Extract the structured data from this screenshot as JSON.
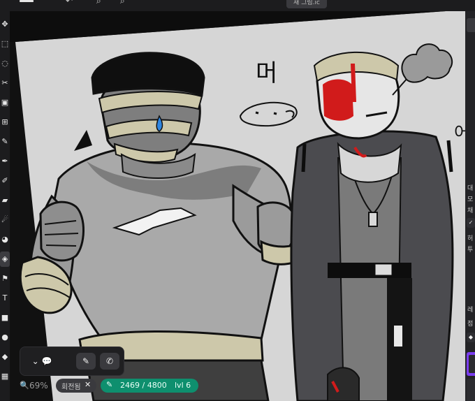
{
  "app": {
    "doc_title": "새 그림.ic",
    "accent": "#0e8f6e",
    "layer_accent": "#7a3cf0"
  },
  "left_toolbar": {
    "tools": [
      {
        "name": "move-tool-icon",
        "glyph": "✥"
      },
      {
        "name": "rect-select-icon",
        "glyph": "⬚"
      },
      {
        "name": "lasso-select-icon",
        "glyph": "◌"
      },
      {
        "name": "magic-wand-icon",
        "glyph": "✂"
      },
      {
        "name": "transform-icon",
        "glyph": "▣"
      },
      {
        "name": "crop-icon",
        "glyph": "⊞"
      },
      {
        "name": "eyedropper-icon",
        "glyph": "✎"
      },
      {
        "name": "pen-icon",
        "glyph": "✒"
      },
      {
        "name": "brush-icon",
        "glyph": "✐"
      },
      {
        "name": "eraser-icon",
        "glyph": "▰"
      },
      {
        "name": "smudge-icon",
        "glyph": "☄"
      },
      {
        "name": "blur-icon",
        "glyph": "◕"
      },
      {
        "name": "bucket-icon",
        "glyph": "◈",
        "active": true
      },
      {
        "name": "gradient-icon",
        "glyph": "⚑"
      },
      {
        "name": "text-icon",
        "glyph": "T"
      },
      {
        "name": "shape-icon",
        "glyph": "■"
      },
      {
        "name": "ellipse-icon",
        "glyph": "●"
      },
      {
        "name": "sticker-icon",
        "glyph": "◆"
      },
      {
        "name": "frame-icon",
        "glyph": "▦"
      }
    ]
  },
  "canvas": {
    "handwriting_1": "머",
    "handwriting_2": "어"
  },
  "right_panel": {
    "labels": [
      "대",
      "모",
      "채",
      "허",
      "투",
      "레",
      "점"
    ],
    "chip_1": "✓",
    "chip_2": "◆"
  },
  "quick_panel": {
    "chat_button": "⌄ 💬",
    "brush_button": "✎",
    "phone_button": "✆"
  },
  "status": {
    "zoom_icon": "🔍",
    "zoom": "69%",
    "rotation_label": "회전됨",
    "rotation_close": "✕",
    "pixel_icon": "✎",
    "pixel_progress": "2469 / 4800",
    "level": "lvl 6"
  }
}
